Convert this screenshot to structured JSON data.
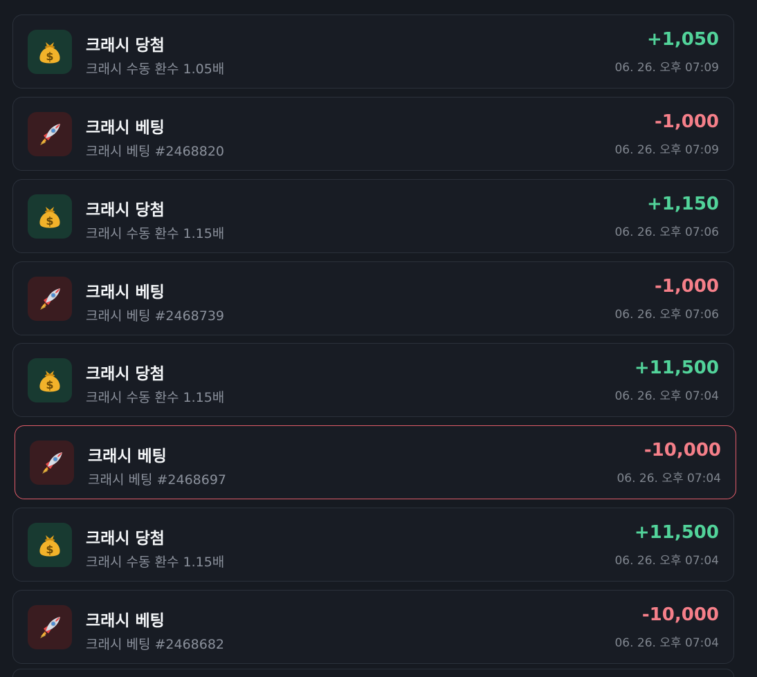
{
  "transactions": [
    {
      "type": "win",
      "icon": "money-bag-icon",
      "title": "크래시 당첨",
      "subtitle": "크래시 수동 환수 1.05배",
      "amount": "+1,050",
      "time": "06. 26. 오후 07:09",
      "selected": false
    },
    {
      "type": "bet",
      "icon": "rocket-icon",
      "title": "크래시 베팅",
      "subtitle": "크래시 베팅 #2468820",
      "amount": "-1,000",
      "time": "06. 26. 오후 07:09",
      "selected": false
    },
    {
      "type": "win",
      "icon": "money-bag-icon",
      "title": "크래시 당첨",
      "subtitle": "크래시 수동 환수 1.15배",
      "amount": "+1,150",
      "time": "06. 26. 오후 07:06",
      "selected": false
    },
    {
      "type": "bet",
      "icon": "rocket-icon",
      "title": "크래시 베팅",
      "subtitle": "크래시 베팅 #2468739",
      "amount": "-1,000",
      "time": "06. 26. 오후 07:06",
      "selected": false
    },
    {
      "type": "win",
      "icon": "money-bag-icon",
      "title": "크래시 당첨",
      "subtitle": "크래시 수동 환수 1.15배",
      "amount": "+11,500",
      "time": "06. 26. 오후 07:04",
      "selected": false
    },
    {
      "type": "bet",
      "icon": "rocket-icon",
      "title": "크래시 베팅",
      "subtitle": "크래시 베팅 #2468697",
      "amount": "-10,000",
      "time": "06. 26. 오후 07:04",
      "selected": true
    },
    {
      "type": "win",
      "icon": "money-bag-icon",
      "title": "크래시 당첨",
      "subtitle": "크래시 수동 환수 1.15배",
      "amount": "+11,500",
      "time": "06. 26. 오후 07:04",
      "selected": false
    },
    {
      "type": "bet",
      "icon": "rocket-icon",
      "title": "크래시 베팅",
      "subtitle": "크래시 베팅 #2468682",
      "amount": "-10,000",
      "time": "06. 26. 오후 07:04",
      "selected": false
    }
  ],
  "colors": {
    "background": "#161a21",
    "positive": "#52d39a",
    "negative": "#f57f89",
    "selected_border": "#e05c69"
  }
}
